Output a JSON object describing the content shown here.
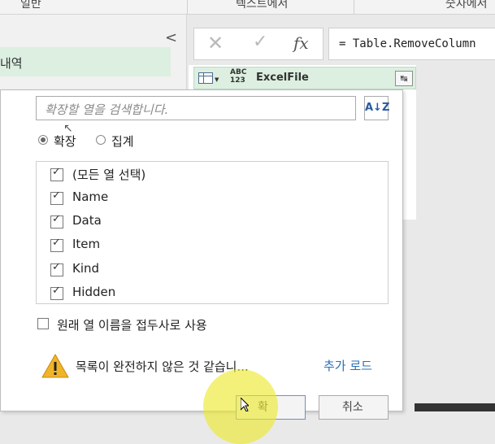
{
  "ribbon": {
    "tab1": "일반",
    "tab2": "텍스트에서",
    "tab3": "숫자에서"
  },
  "left_pane": {
    "collapse_glyph": "<",
    "selected_query": "내역"
  },
  "formula_bar": {
    "cancel_glyph": "✕",
    "commit_glyph": "✓",
    "fx_label": "fx",
    "formula": "= Table.RemoveColumn"
  },
  "column_header": {
    "type_badge": "ABC\n123",
    "name": "ExcelFile",
    "expand_glyph": "↹"
  },
  "expand_dialog": {
    "search_placeholder": "확장할 열을 검색합니다.",
    "sort_glyph": "A↓Z",
    "radio_expand": "확장",
    "radio_aggregate": "집계",
    "items": [
      {
        "label": "(모든 열 선택)",
        "checked": true
      },
      {
        "label": "Name",
        "checked": true
      },
      {
        "label": "Data",
        "checked": true
      },
      {
        "label": "Item",
        "checked": true
      },
      {
        "label": "Kind",
        "checked": true
      },
      {
        "label": "Hidden",
        "checked": true
      }
    ],
    "prefix_label": "원래 열 이름을 접두사로 사용",
    "warning_text": "목록이 완전하지 않은 것 같습니...",
    "load_more": "추가 로드",
    "ok_label": "확",
    "cancel_label": "취소"
  },
  "colors": {
    "accent_green": "#dcefe0",
    "link_blue": "#2a6fb8",
    "warning_yellow": "#f0b429"
  }
}
